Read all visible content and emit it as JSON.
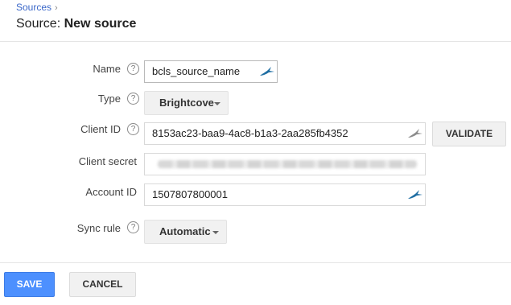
{
  "breadcrumb": {
    "link": "Sources",
    "separator": "›"
  },
  "header": {
    "title_prefix": "Source:",
    "title_main": "New source"
  },
  "form": {
    "name": {
      "label": "Name",
      "value": "bcls_source_name"
    },
    "type": {
      "label": "Type",
      "selected": "Brightcove"
    },
    "client_id": {
      "label": "Client ID",
      "value": "8153ac23-baa9-4ac8-b1a3-2aa285fb4352",
      "validate_label": "VALIDATE"
    },
    "client_secret": {
      "label": "Client secret"
    },
    "account_id": {
      "label": "Account ID",
      "value": "1507807800001"
    },
    "sync_rule": {
      "label": "Sync rule",
      "selected": "Automatic"
    },
    "help_glyph": "?"
  },
  "footer": {
    "save_label": "SAVE",
    "cancel_label": "CANCEL"
  },
  "icons": {
    "help": "help-circle-icon",
    "password_manager": "keepass-bird-icon",
    "dropdown": "caret-down-icon"
  },
  "colors": {
    "primary": "#4d90fe",
    "link": "#3b68c9",
    "icon_teal": "#1f6ea3"
  }
}
